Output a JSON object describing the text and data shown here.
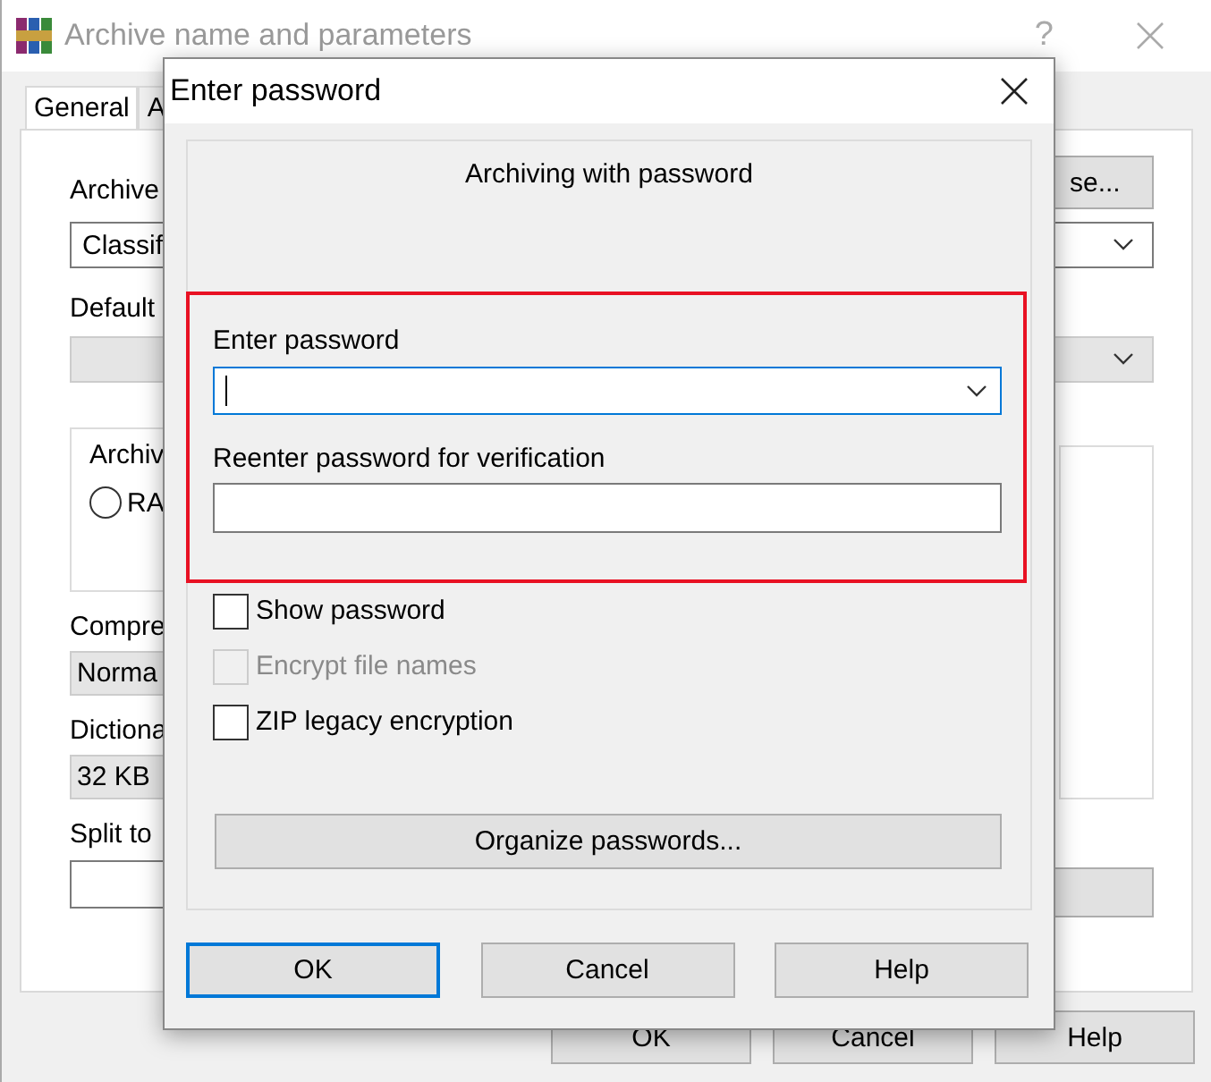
{
  "main_window": {
    "title": "Archive name and parameters",
    "help_glyph": "?",
    "tabs": [
      {
        "label": "General",
        "selected": true
      },
      {
        "label": "A",
        "selected": false
      }
    ],
    "archive_name": {
      "label": "Archive",
      "value": "Classif",
      "browse": "se..."
    },
    "default_profile": {
      "label": "Default"
    },
    "archive_format": {
      "label": "Archiv",
      "options": [
        {
          "label": "RA",
          "selected": false
        }
      ]
    },
    "compression": {
      "label": "Compre",
      "value": "Norma"
    },
    "dictionary": {
      "label": "Dictiona",
      "value": "32 KB"
    },
    "split": {
      "label": "Split to"
    },
    "buttons": [
      "OK",
      "Cancel",
      "Help"
    ]
  },
  "dialog": {
    "title": "Enter password",
    "heading": "Archiving with password",
    "password": {
      "label": "Enter password",
      "focused": true
    },
    "verify": {
      "label": "Reenter password for verification"
    },
    "options": [
      {
        "label": "Show password",
        "checked": false,
        "disabled": false
      },
      {
        "label": "Encrypt file names",
        "checked": false,
        "disabled": true
      },
      {
        "label": "ZIP legacy encryption",
        "checked": false,
        "disabled": false
      }
    ],
    "organize": "Organize passwords...",
    "buttons": [
      {
        "label": "OK",
        "default": true
      },
      {
        "label": "Cancel",
        "default": false
      },
      {
        "label": "Help",
        "default": false
      }
    ]
  }
}
